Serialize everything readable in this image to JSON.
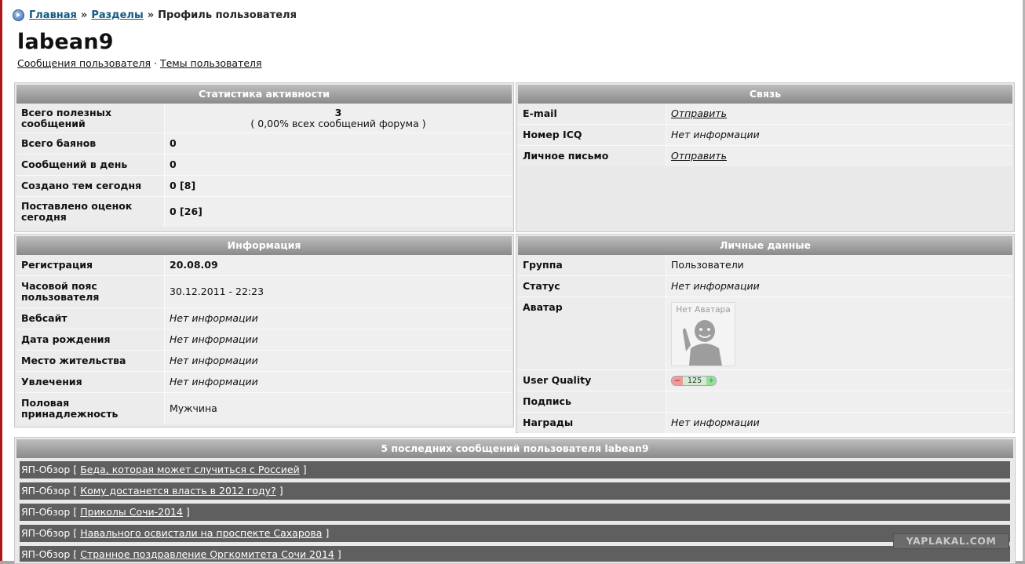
{
  "breadcrumb": {
    "home": "Главная",
    "sep1": "»",
    "sections": "Разделы",
    "sep2": "»",
    "current": "Профиль пользователя"
  },
  "username": "labean9",
  "sublinks": {
    "messages": "Сообщения пользователя",
    "dot": "·",
    "topics": "Темы пользователя"
  },
  "stats": {
    "title": "Статистика активности",
    "useful_label": "Всего полезных сообщений",
    "useful_value": "3",
    "useful_percent": "( 0,00% всех сообщений форума )",
    "bayans_label": "Всего баянов",
    "bayans_value": "0",
    "per_day_label": "Сообщений в день",
    "per_day_value": "0",
    "topics_today_label": "Создано тем сегодня",
    "topics_today_value": "0 [8]",
    "ratings_today_label": "Поставлено оценок сегодня",
    "ratings_today_value": "0 [26]"
  },
  "contact": {
    "title": "Связь",
    "email_label": "E-mail",
    "email_value": "Отправить",
    "icq_label": "Номер ICQ",
    "icq_value": "Нет информации",
    "pm_label": "Личное письмо",
    "pm_value": "Отправить"
  },
  "info": {
    "title": "Информация",
    "reg_label": "Регистрация",
    "reg_value": "20.08.09",
    "tz_label": "Часовой пояс пользователя",
    "tz_value": "30.12.2011 - 22:23",
    "site_label": "Вебсайт",
    "site_value": "Нет информации",
    "birth_label": "Дата рождения",
    "birth_value": "Нет информации",
    "place_label": "Место жительства",
    "place_value": "Нет информации",
    "hobby_label": "Увлечения",
    "hobby_value": "Нет информации",
    "gender_label": "Половая принадлежность",
    "gender_value": "Мужчина"
  },
  "personal": {
    "title": "Личные данные",
    "group_label": "Группа",
    "group_value": "Пользователи",
    "status_label": "Статус",
    "status_value": "Нет информации",
    "avatar_label": "Аватар",
    "avatar_caption": "Нет Аватара",
    "quality_label": "User Quality",
    "quality_minus": "−",
    "quality_value": "125",
    "quality_plus": "+",
    "signature_label": "Подпись",
    "awards_label": "Награды",
    "awards_value": "Нет информации"
  },
  "posts": {
    "title": "5 последних сообщений пользователя labean9",
    "items": [
      {
        "prefix": "ЯП-Обзор",
        "open": "[",
        "title": "Беда, которая может случиться с Россией",
        "close": "]"
      },
      {
        "prefix": "ЯП-Обзор",
        "open": "[",
        "title": "Кому достанется власть в 2012 году?",
        "close": "]"
      },
      {
        "prefix": "ЯП-Обзор",
        "open": "[",
        "title": "Приколы Сочи-2014",
        "close": "]"
      },
      {
        "prefix": "ЯП-Обзор",
        "open": "[",
        "title": "Навального освистали на проспекте Сахарова",
        "close": "]"
      },
      {
        "prefix": "ЯП-Обзор",
        "open": "[",
        "title": "Странное поздравление Оргкомитета Сочи 2014",
        "close": "]"
      }
    ]
  },
  "watermark": "YAPLAKAL.COM",
  "colors": {
    "header_top": "#bdbdbd",
    "header_bottom": "#8a8a8a",
    "link": "#155a82",
    "post_row": "#5f5f5f"
  }
}
